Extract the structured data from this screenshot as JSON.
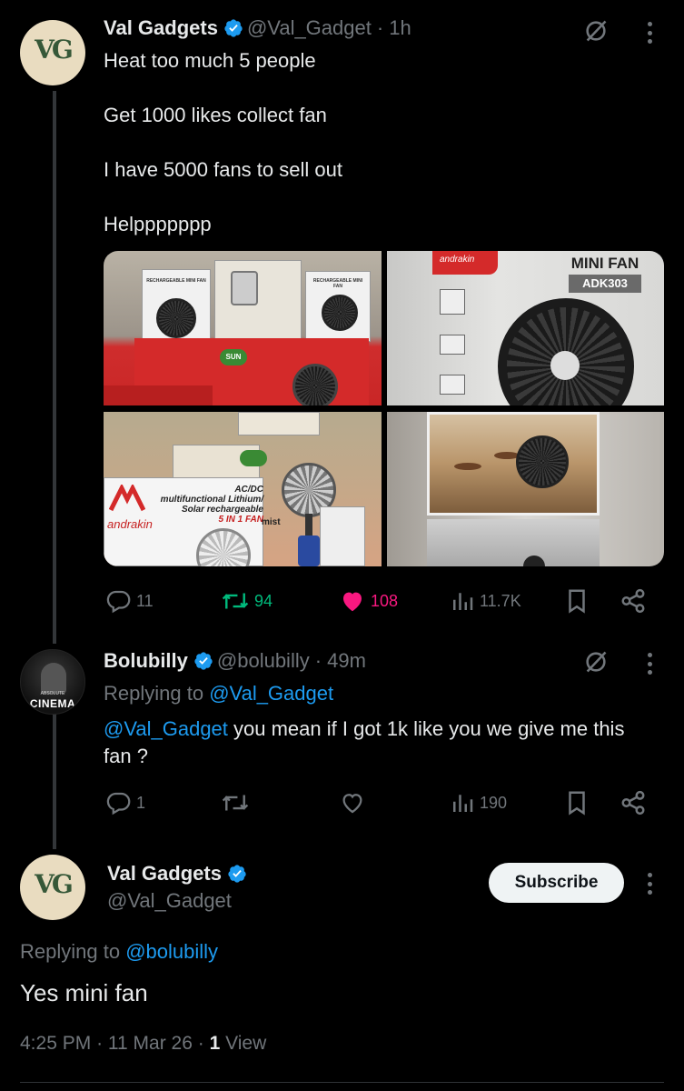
{
  "tweet1": {
    "name": "Val Gadgets",
    "handle": "@Val_Gadget",
    "time": "· 1h",
    "lines": [
      "Heat too much 5 people",
      "Get 1000 likes collect fan",
      "I have 5000 fans to sell out",
      "Helppppppp"
    ],
    "media": {
      "img2_title": "MINI FAN",
      "img2_model": "ADK303",
      "img2_brand": "andrakin",
      "img3_line1": "AC/DC",
      "img3_line2": "multifunctional Lithium/",
      "img3_line3": "Solar rechargeable",
      "img3_line4": "5 IN 1 FAN",
      "img3_brand": "andrakin",
      "img3_mist": "mist",
      "img1_label": "RECHARGEABLE MINI FAN",
      "img1_label2": "RECHARGEABLE MINI FAN",
      "img1_sun": "SUN"
    },
    "replies": "11",
    "retweets": "94",
    "likes": "108",
    "views": "11.7K"
  },
  "tweet2": {
    "name": "Bolubilly",
    "handle": "@bolubilly",
    "time": "· 49m",
    "replying_prefix": "Replying to",
    "replying_to": "@Val_Gadget",
    "mention": "@Val_Gadget",
    "text": " you mean if I got 1k like you we give me this fan ?",
    "avatar_text": "CINEMA",
    "avatar_sub": "ABSOLUTE",
    "replies": "1",
    "retweets": "",
    "likes": "",
    "views": "190"
  },
  "tweet3": {
    "name": "Val Gadgets",
    "handle": "@Val_Gadget",
    "subscribe_label": "Subscribe",
    "replying_prefix": "Replying to",
    "replying_to": "@bolubilly",
    "text": "Yes mini fan",
    "time": "4:25 PM",
    "date": "11 Mar 26",
    "views_count": "1",
    "views_label": "View"
  },
  "colors": {
    "background": "#000000",
    "text": "#e7e9ea",
    "muted": "#71767b",
    "link": "#1d9bf0",
    "retweet": "#00ba7c",
    "like": "#f91880"
  }
}
